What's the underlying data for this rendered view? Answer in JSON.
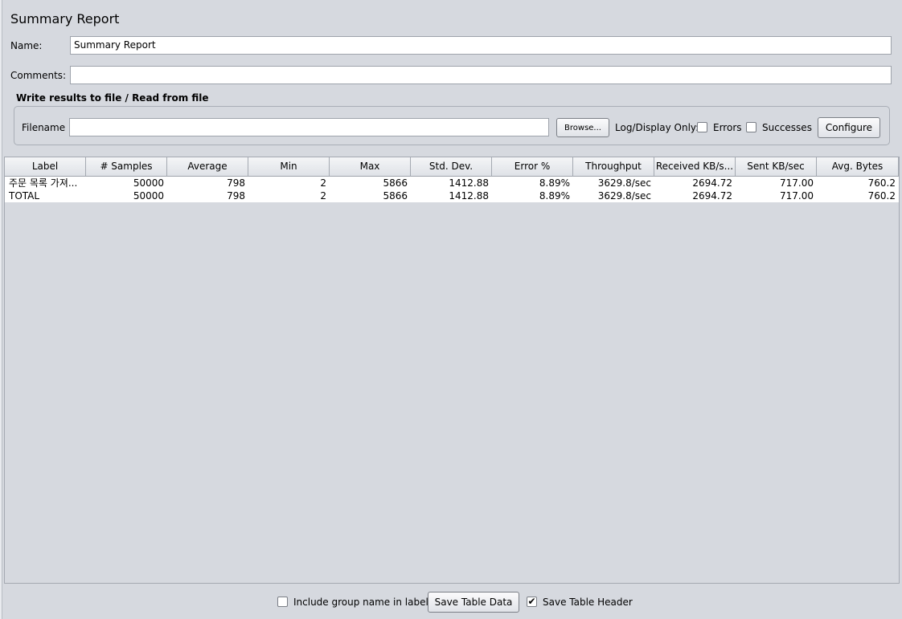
{
  "panel": {
    "title": "Summary Report"
  },
  "name_row": {
    "label": "Name:",
    "value": "Summary Report"
  },
  "comments_row": {
    "label": "Comments:",
    "value": ""
  },
  "file_section": {
    "title": "Write results to file / Read from file",
    "filename_label": "Filename",
    "filename_value": "",
    "browse_label": "Browse...",
    "log_display_label": "Log/Display Only:",
    "errors_label": "Errors",
    "errors_checked": false,
    "successes_label": "Successes",
    "successes_checked": false,
    "configure_label": "Configure"
  },
  "table": {
    "columns": [
      "Label",
      "# Samples",
      "Average",
      "Min",
      "Max",
      "Std. Dev.",
      "Error %",
      "Throughput",
      "Received KB/s...",
      "Sent KB/sec",
      "Avg. Bytes"
    ],
    "rows": [
      [
        "주문 목록 가져...",
        "50000",
        "798",
        "2",
        "5866",
        "1412.88",
        "8.89%",
        "3629.8/sec",
        "2694.72",
        "717.00",
        "760.2"
      ],
      [
        "TOTAL",
        "50000",
        "798",
        "2",
        "5866",
        "1412.88",
        "8.89%",
        "3629.8/sec",
        "2694.72",
        "717.00",
        "760.2"
      ]
    ]
  },
  "footer": {
    "include_group_label": "Include group name in label?",
    "include_group_checked": false,
    "save_table_data_label": "Save Table Data",
    "save_table_header_label": "Save Table Header",
    "save_table_header_checked": true
  }
}
